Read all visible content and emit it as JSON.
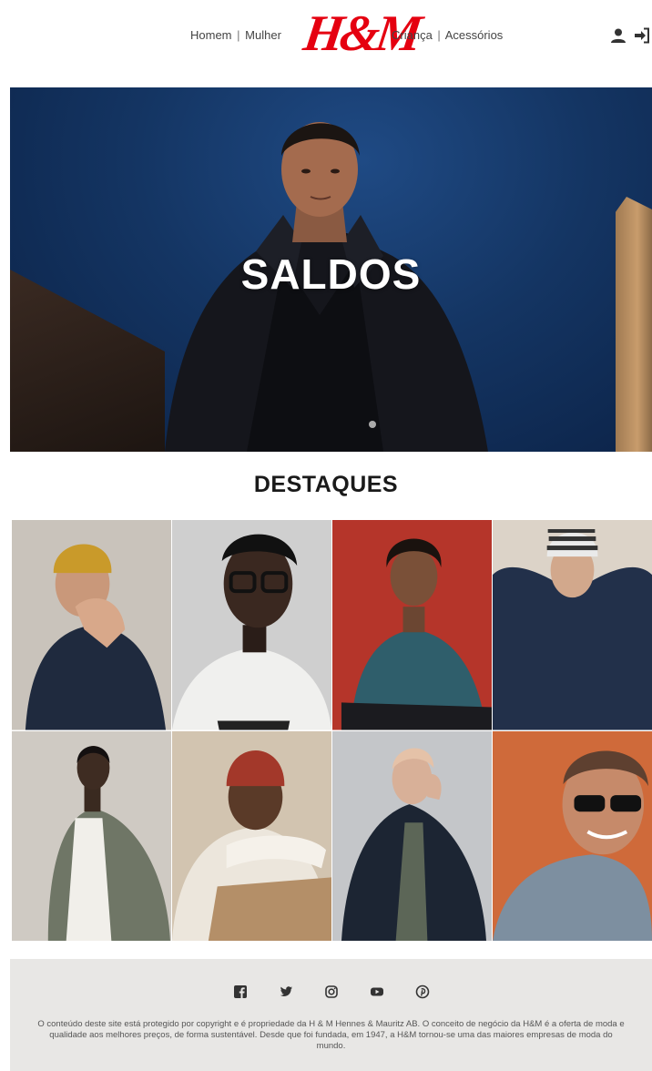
{
  "header": {
    "nav_left": [
      "Homem",
      "Mulher"
    ],
    "nav_right": [
      "Criança",
      "Acessórios"
    ],
    "separator": "|",
    "logo": "H&M",
    "icons": [
      "user-icon",
      "sign-in-icon"
    ]
  },
  "hero": {
    "title": "SALDOS"
  },
  "highlights": {
    "title": "DESTAQUES",
    "tiles": [
      "photo-man-yellow-beanie",
      "photo-man-glasses",
      "photo-man-teal-sweater",
      "photo-man-striped-beanie",
      "photo-man-bomber-jacket",
      "photo-man-red-beanie",
      "photo-man-dark-jacket",
      "photo-man-sunglasses"
    ]
  },
  "footer": {
    "social_icons": [
      "facebook-icon",
      "twitter-icon",
      "instagram-icon",
      "youtube-icon",
      "pinterest-icon"
    ],
    "text": "O conteúdo deste site está protegido por copyright e é propriedade da H & M Hennes & Mauritz AB. O conceito de negócio da H&M é a oferta de moda e qualidade aos melhores preços, de forma sustentável. Desde que foi fundada, em 1947, a H&M tornou-se uma das maiores empresas de moda do mundo."
  },
  "colors": {
    "brand_red": "#e50010",
    "footer_bg": "#e8e7e5",
    "hero_sky": "#143563"
  }
}
